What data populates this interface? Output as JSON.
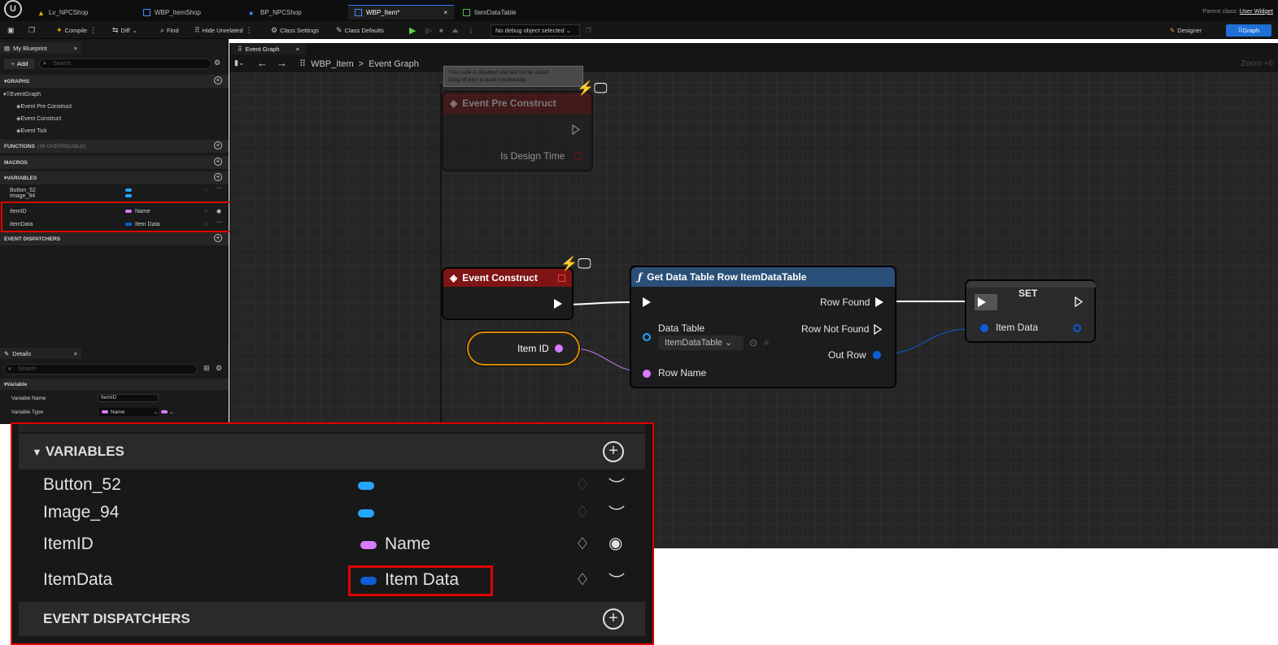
{
  "tabs": {
    "items": [
      {
        "label": "Lv_NPCShop"
      },
      {
        "label": "WBP_ItemShop"
      },
      {
        "label": "BP_NPCShop"
      },
      {
        "label": "WBP_Item*"
      },
      {
        "label": "ItemDataTable"
      }
    ],
    "close": "×",
    "parent_class_label": "Parent class:",
    "parent_class_value": "User Widget"
  },
  "toolbar": {
    "compile": "Compile",
    "diff": "Diff",
    "find": "Find",
    "hide_unrelated": "Hide Unrelated",
    "class_settings": "Class Settings",
    "class_defaults": "Class Defaults",
    "debug_object": "No debug object selected",
    "designer": "Designer",
    "graph": "Graph"
  },
  "my_blueprint": {
    "tab_label": "My Blueprint",
    "add_label": "Add",
    "search_placeholder": "Search",
    "graphs_header": "GRAPHS",
    "event_graph": "EventGraph",
    "events": [
      "Event Pre Construct",
      "Event Construct",
      "Event Tick"
    ],
    "functions_header": "FUNCTIONS",
    "functions_count": "(36 OVERRIDABLE)",
    "macros_header": "MACROS",
    "variables_header": "VARIABLES",
    "variables": [
      {
        "name": "Button_52",
        "type": ""
      },
      {
        "name": "Image_94",
        "type": ""
      },
      {
        "name": "ItemID",
        "type": "Name"
      },
      {
        "name": "ItemData",
        "type": "Item Data"
      }
    ],
    "dispatchers_header": "EVENT DISPATCHERS"
  },
  "details": {
    "tab_label": "Details",
    "search_placeholder": "Search",
    "section": "Variable",
    "variable_name_label": "Variable Name",
    "variable_name_value": "ItemID",
    "variable_type_label": "Variable Type",
    "variable_type_value": "Name"
  },
  "graph": {
    "tab_label": "Event Graph",
    "breadcrumb_root": "WBP_Item",
    "breadcrumb_sep": ">",
    "breadcrumb_current": "Event Graph",
    "zoom": "Zoom +6",
    "disabled_note_line1": "This node is disabled and will not be called.",
    "disabled_note_line2": "Drag off pins to build functionality.",
    "pre_construct_title": "Event Pre Construct",
    "is_design_time": "Is Design Time",
    "construct_title": "Event Construct",
    "get_row_title": "Get Data Table Row ItemDataTable",
    "row_found": "Row Found",
    "row_not_found": "Row Not Found",
    "data_table_label": "Data Table",
    "data_table_value": "ItemDataTable",
    "out_row": "Out Row",
    "row_name": "Row Name",
    "item_id_node": "Item ID",
    "set_title": "SET",
    "set_item_data": "Item Data"
  },
  "colors": {
    "highlight": "#e00000",
    "accent_blue": "#1e6fd6",
    "event_red": "#8a1414",
    "function_blue": "#27507a",
    "pin_magenta": "#d77bff",
    "pin_blue": "#0f5cd8",
    "pin_cyan": "#23a7ff"
  }
}
